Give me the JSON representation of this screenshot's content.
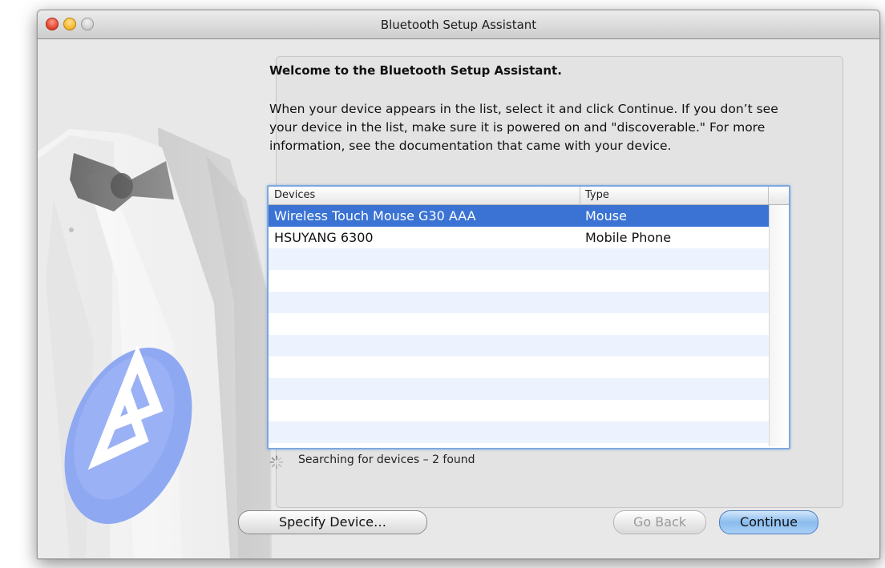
{
  "window": {
    "title": "Bluetooth Setup Assistant",
    "controls": [
      "close-button",
      "minimize-button",
      "zoom-button"
    ]
  },
  "content": {
    "heading": "Welcome to the Bluetooth Setup Assistant.",
    "intro": "When your device appears in the list, select it and click Continue. If you don’t see your device in the list, make sure it is powered on and \"discoverable.\" For more information, see the documentation that came with your device."
  },
  "device_table": {
    "columns": [
      "Devices",
      "Type"
    ],
    "rows": [
      {
        "device": "Wireless Touch Mouse G30 AAA",
        "type": "Mouse",
        "selected": true
      },
      {
        "device": "HSUYANG 6300",
        "type": "Mobile Phone",
        "selected": false
      }
    ]
  },
  "status": {
    "text": "Searching for devices – 2 found",
    "icon": "spinner-icon"
  },
  "buttons": {
    "specify": "Specify Device…",
    "back": "Go Back",
    "continue": "Continue"
  },
  "colors": {
    "selection": "#3a73d3",
    "stripe": "#edf3fe",
    "continue_button": "#8bbcee",
    "bluetooth_badge": "#8fa8f2"
  }
}
